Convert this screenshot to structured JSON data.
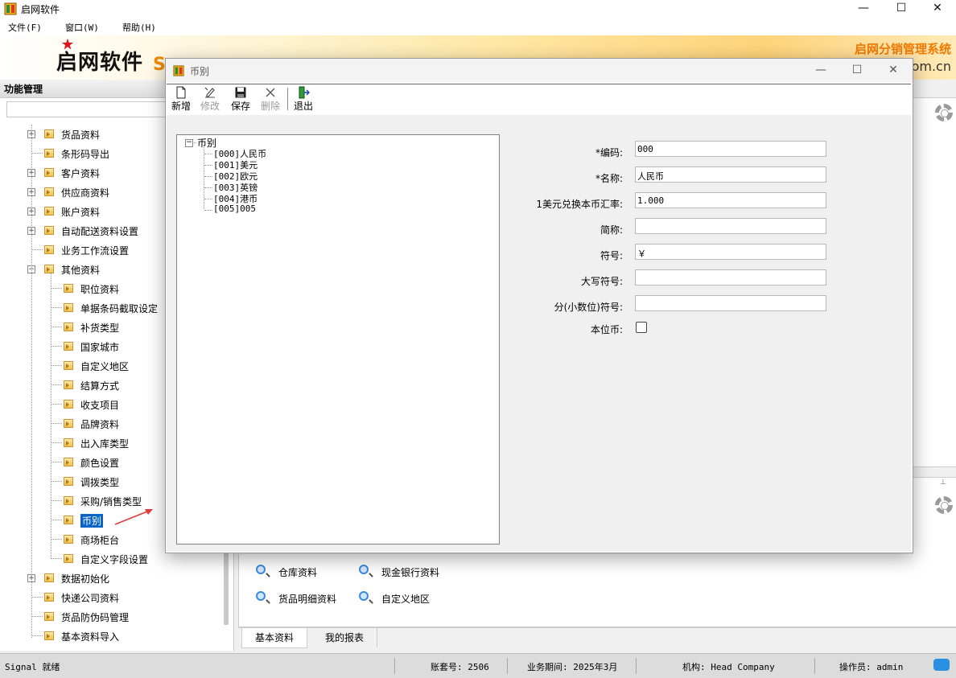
{
  "app": {
    "title": "启网软件"
  },
  "menu": [
    "文件(F)",
    "窗口(W)",
    "帮助(H)"
  ],
  "banner": {
    "brand": "启网软件",
    "brand_suffix": "S",
    "slogan": "启网分销管理系统",
    "domain": "om.cn"
  },
  "left_panel": {
    "title": "功能管理",
    "items": [
      {
        "label": "货品资料",
        "level": 1,
        "expandable": true
      },
      {
        "label": "条形码导出",
        "level": 1,
        "expandable": false
      },
      {
        "label": "客户资料",
        "level": 1,
        "expandable": true
      },
      {
        "label": "供应商资料",
        "level": 1,
        "expandable": true
      },
      {
        "label": "账户资料",
        "level": 1,
        "expandable": true
      },
      {
        "label": "自动配送资料设置",
        "level": 1,
        "expandable": true
      },
      {
        "label": "业务工作流设置",
        "level": 1,
        "expandable": false
      },
      {
        "label": "其他资料",
        "level": 1,
        "expandable": true,
        "expanded": true
      },
      {
        "label": "职位资料",
        "level": 2
      },
      {
        "label": "单据条码截取设定",
        "level": 2
      },
      {
        "label": "补货类型",
        "level": 2
      },
      {
        "label": "国家城市",
        "level": 2
      },
      {
        "label": "自定义地区",
        "level": 2
      },
      {
        "label": "结算方式",
        "level": 2
      },
      {
        "label": "收支项目",
        "level": 2
      },
      {
        "label": "品牌资料",
        "level": 2
      },
      {
        "label": "出入库类型",
        "level": 2
      },
      {
        "label": "颜色设置",
        "level": 2
      },
      {
        "label": "调拨类型",
        "level": 2
      },
      {
        "label": "采购/销售类型",
        "level": 2
      },
      {
        "label": "币别",
        "level": 2,
        "selected": true
      },
      {
        "label": "商场柜台",
        "level": 2
      },
      {
        "label": "自定义字段设置",
        "level": 2
      },
      {
        "label": "数据初始化",
        "level": 1,
        "expandable": true
      },
      {
        "label": "快递公司资料",
        "level": 1,
        "expandable": false
      },
      {
        "label": "货品防伪码管理",
        "level": 1,
        "expandable": false
      },
      {
        "label": "基本资料导入",
        "level": 1,
        "expandable": false
      }
    ]
  },
  "shortcuts": [
    {
      "label": "仓库资料"
    },
    {
      "label": "现金银行资料"
    },
    {
      "label": "货品明细资料"
    },
    {
      "label": "自定义地区"
    }
  ],
  "bottom_tabs": [
    "基本资料",
    "我的报表"
  ],
  "status": {
    "signal": "Signal 就绪",
    "account": "账套号: 2506",
    "period": "业务期间: 2025年3月",
    "org": "机构: Head Company",
    "operator": "操作员: admin"
  },
  "dialog": {
    "title": "币别",
    "toolbar": [
      {
        "label": "新增",
        "icon": "new-doc-icon",
        "enabled": true
      },
      {
        "label": "修改",
        "icon": "edit-icon",
        "enabled": false
      },
      {
        "label": "保存",
        "icon": "save-icon",
        "enabled": true
      },
      {
        "label": "删除",
        "icon": "delete-icon",
        "enabled": false
      },
      {
        "label": "退出",
        "icon": "exit-icon",
        "enabled": true
      }
    ],
    "tree": {
      "root": "币别",
      "items": [
        "[000]人民币",
        "[001]美元",
        "[002]欧元",
        "[003]英镑",
        "[004]港币",
        "[005]005"
      ]
    },
    "form": {
      "code_label": "*编码:",
      "code_value": "000",
      "name_label": "*名称:",
      "name_value": "人民币",
      "rate_label": "1美元兑换本币汇率:",
      "rate_value": "1.000",
      "short_label": "简称:",
      "short_value": "",
      "symbol_label": "符号:",
      "symbol_value": "￥",
      "upper_symbol_label": "大写符号:",
      "upper_symbol_value": "",
      "cent_symbol_label": "分(小数位)符号:",
      "cent_symbol_value": "",
      "base_currency_label": "本位币:",
      "base_currency_checked": false
    }
  },
  "colors": {
    "accent": "#0a64c8",
    "brand_orange": "#f07a00"
  }
}
